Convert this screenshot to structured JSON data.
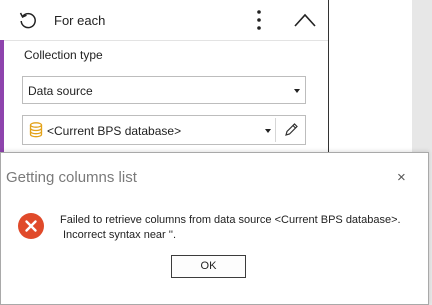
{
  "node": {
    "title": "For each",
    "collection_type_label": "Collection type",
    "collection_type_value": "Data source",
    "data_source_value": "<Current BPS database>"
  },
  "dialog": {
    "title": "Getting columns list",
    "close_glyph": "×",
    "message_line1": "Failed to retrieve columns from data source <Current BPS database>.",
    "message_line2": "Incorrect syntax near ''.",
    "ok_label": "OK"
  },
  "colors": {
    "accent": "#8e44ad",
    "error": "#e04a2a",
    "database_icon": "#e3a21a"
  },
  "icons": [
    "loop-icon",
    "more-vertical-icon",
    "chevron-up-icon",
    "dropdown-caret-icon",
    "database-icon",
    "pencil-icon",
    "close-icon",
    "error-icon"
  ]
}
